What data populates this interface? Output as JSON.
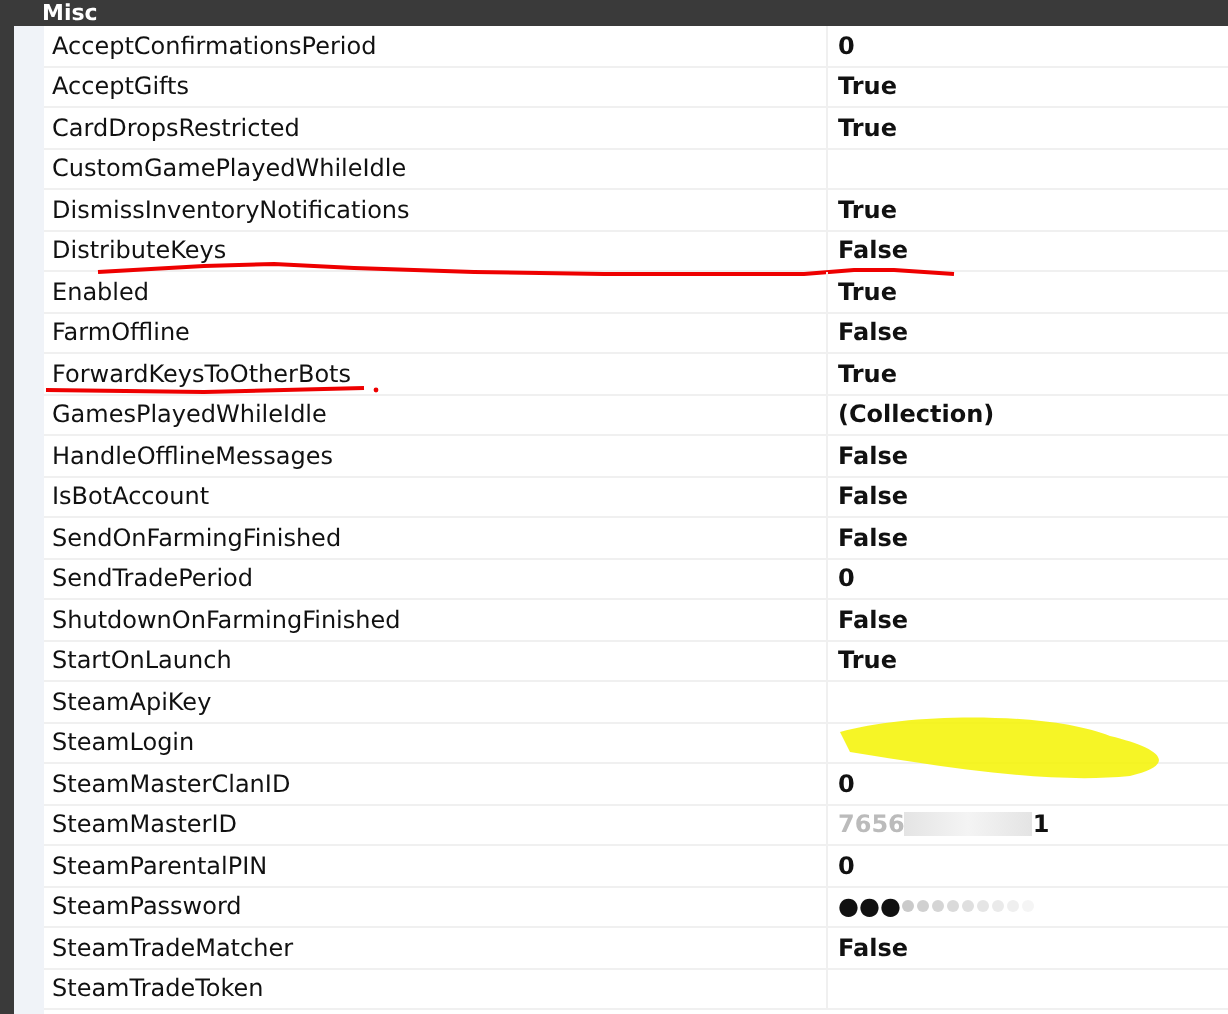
{
  "category": {
    "title": "Misc"
  },
  "properties": [
    {
      "name": "AcceptConfirmationsPeriod",
      "value": "0"
    },
    {
      "name": "AcceptGifts",
      "value": "True"
    },
    {
      "name": "CardDropsRestricted",
      "value": "True"
    },
    {
      "name": "CustomGamePlayedWhileIdle"
    },
    {
      "name": "DismissInventoryNotifications",
      "value": "True"
    },
    {
      "name": "DistributeKeys",
      "value": "False",
      "kind": "underlined-long"
    },
    {
      "name": "Enabled",
      "value": "True"
    },
    {
      "name": "FarmOffline",
      "value": "False"
    },
    {
      "name": "ForwardKeysToOtherBots",
      "value": "True",
      "kind": "underlined"
    },
    {
      "name": "GamesPlayedWhileIdle",
      "value": "(Collection)"
    },
    {
      "name": "HandleOfflineMessages",
      "value": "False"
    },
    {
      "name": "IsBotAccount",
      "value": "False"
    },
    {
      "name": "SendOnFarmingFinished",
      "value": "False"
    },
    {
      "name": "SendTradePeriod",
      "value": "0"
    },
    {
      "name": "ShutdownOnFarmingFinished",
      "value": "False"
    },
    {
      "name": "StartOnLaunch",
      "value": "True"
    },
    {
      "name": "SteamApiKey"
    },
    {
      "name": "SteamLogin",
      "kind": "scribbled"
    },
    {
      "name": "SteamMasterClanID",
      "value": "0"
    },
    {
      "name": "SteamMasterID",
      "value": "7656",
      "value_end": "1",
      "kind": "blurred"
    },
    {
      "name": "SteamParentalPIN",
      "value": "0"
    },
    {
      "name": "SteamPassword",
      "value": "●●●",
      "kind": "password"
    },
    {
      "name": "SteamTradeMatcher",
      "value": "False"
    },
    {
      "name": "SteamTradeToken"
    }
  ]
}
